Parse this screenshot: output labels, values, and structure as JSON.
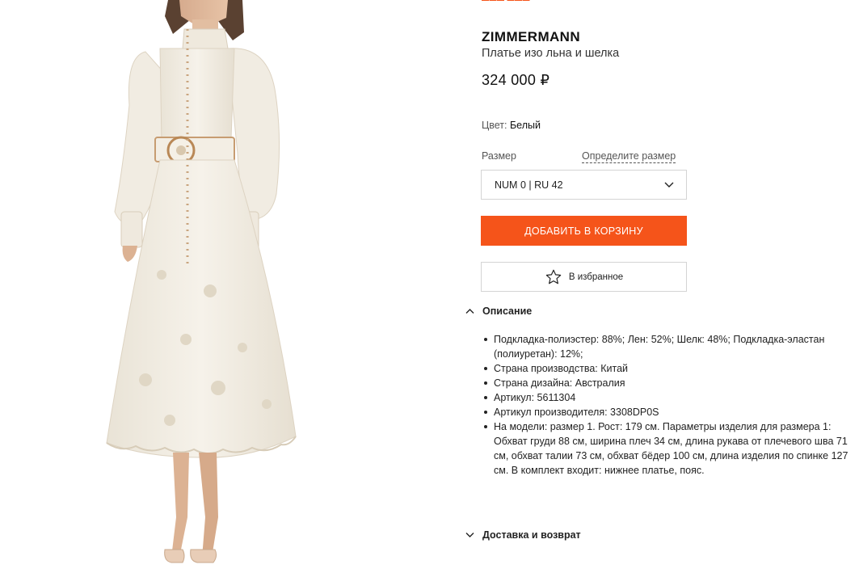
{
  "brand": "ZIMMERMANN",
  "product_name": "Платье изо льна и шелка",
  "price": "324 000 ₽",
  "color": {
    "label": "Цвет:",
    "value": "Белый"
  },
  "size": {
    "label": "Размер",
    "guide_link": "Определите размер",
    "selected": "NUM 0 | RU 42"
  },
  "buttons": {
    "add_to_cart": "ДОБАВИТЬ В КОРЗИНУ",
    "favorite": "В избранное"
  },
  "sections": {
    "description": {
      "title": "Описание",
      "expanded": true,
      "items": [
        "Подкладка-полиэстер: 88%; Лен: 52%; Шелк: 48%; Подкладка-эластан (полиуретан): 12%;",
        "Страна производства: Китай",
        "Страна дизайна: Австралия",
        "Артикул: 5611304",
        "Артикул производителя: 3308DP0S",
        "На модели: размер 1. Рост: 179 см. Параметры изделия для размера 1: Обхват груди 88 см, ширина плеч 34 см, длина рукава от плечевого шва 71 см, обхват талии 73 см, обхват бёдер 100 см, длина изделия по спинке 127 см. В комплект входит: нижнее платье, пояс."
      ]
    },
    "delivery": {
      "title": "Доставка и возврат",
      "expanded": false
    }
  },
  "icons": {
    "size_dropdown": "chevron-down-icon",
    "favorite": "star-outline-icon",
    "description_toggle": "chevron-up-icon",
    "delivery_toggle": "chevron-down-icon"
  },
  "colors": {
    "accent": "#f5541a",
    "text": "#1a1a1a",
    "border": "#d4d4d4"
  }
}
